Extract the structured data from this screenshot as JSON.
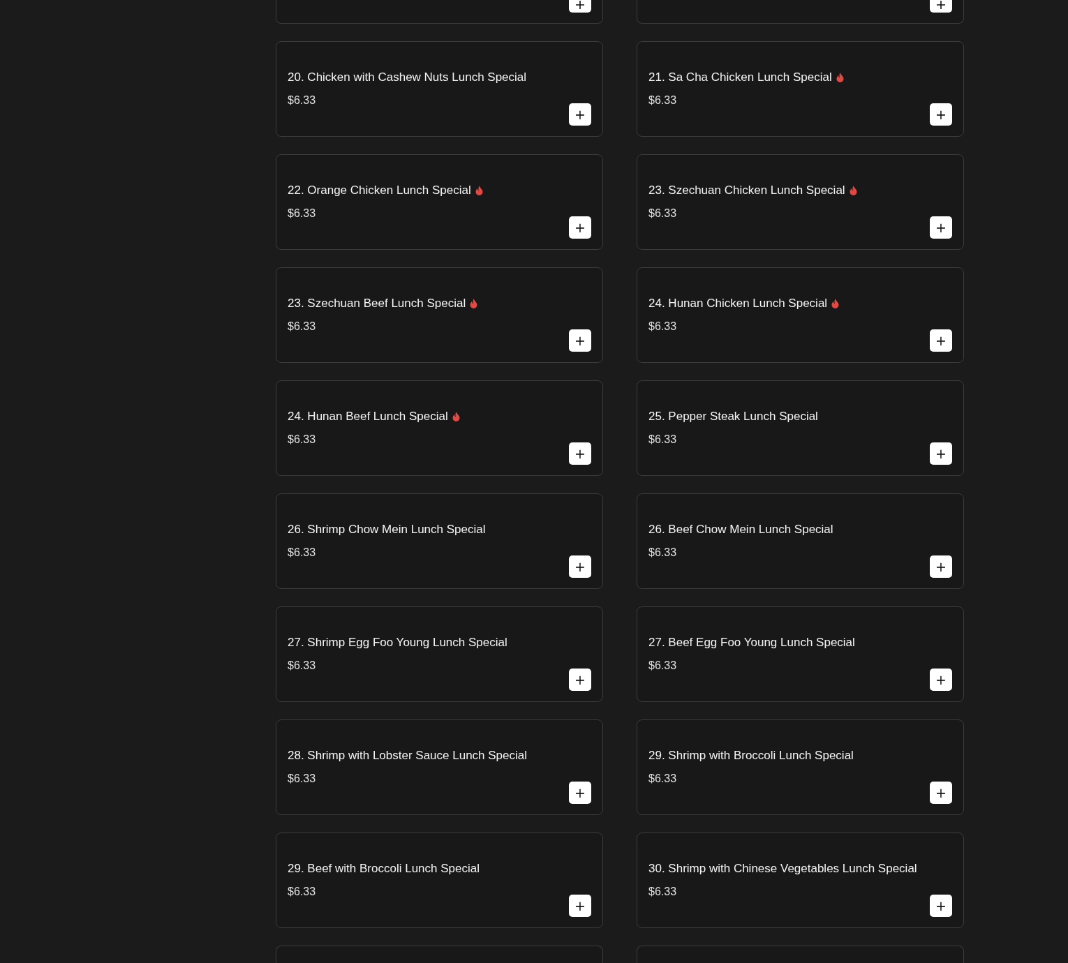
{
  "items": [
    {
      "kind": "partial_top"
    },
    {
      "kind": "partial_top"
    },
    {
      "kind": "item",
      "title": "20. Chicken with Cashew Nuts Lunch Special",
      "spicy": false,
      "price": "$6.33",
      "add": "+"
    },
    {
      "kind": "item",
      "title": "21. Sa Cha Chicken Lunch Special",
      "spicy": true,
      "price": "$6.33",
      "add": "+"
    },
    {
      "kind": "item",
      "title": "22. Orange Chicken Lunch Special",
      "spicy": true,
      "price": "$6.33",
      "add": "+"
    },
    {
      "kind": "item",
      "title": "23. Szechuan Chicken Lunch Special",
      "spicy": true,
      "price": "$6.33",
      "add": "+"
    },
    {
      "kind": "item",
      "title": "23. Szechuan Beef Lunch Special",
      "spicy": true,
      "price": "$6.33",
      "add": "+"
    },
    {
      "kind": "item",
      "title": "24. Hunan Chicken Lunch Special",
      "spicy": true,
      "price": "$6.33",
      "add": "+"
    },
    {
      "kind": "item",
      "title": "24. Hunan Beef Lunch Special",
      "spicy": true,
      "price": "$6.33",
      "add": "+"
    },
    {
      "kind": "item",
      "title": "25. Pepper Steak Lunch Special",
      "spicy": false,
      "price": "$6.33",
      "add": "+"
    },
    {
      "kind": "item",
      "title": "26. Shrimp Chow Mein Lunch Special",
      "spicy": false,
      "price": "$6.33",
      "add": "+"
    },
    {
      "kind": "item",
      "title": "26. Beef Chow Mein Lunch Special",
      "spicy": false,
      "price": "$6.33",
      "add": "+"
    },
    {
      "kind": "item",
      "title": "27. Shrimp Egg Foo Young Lunch Special",
      "spicy": false,
      "price": "$6.33",
      "add": "+"
    },
    {
      "kind": "item",
      "title": "27. Beef Egg Foo Young Lunch Special",
      "spicy": false,
      "price": "$6.33",
      "add": "+"
    },
    {
      "kind": "item",
      "title": "28. Shrimp with Lobster Sauce Lunch Special",
      "spicy": false,
      "price": "$6.33",
      "add": "+"
    },
    {
      "kind": "item",
      "title": "29. Shrimp with Broccoli Lunch Special",
      "spicy": false,
      "price": "$6.33",
      "add": "+"
    },
    {
      "kind": "item",
      "title": "29. Beef with Broccoli Lunch Special",
      "spicy": false,
      "price": "$6.33",
      "add": "+"
    },
    {
      "kind": "item",
      "title": "30. Shrimp with Chinese Vegetables Lunch Special",
      "spicy": false,
      "price": "$6.33",
      "add": "+"
    },
    {
      "kind": "partial_bottom"
    },
    {
      "kind": "partial_bottom"
    }
  ]
}
